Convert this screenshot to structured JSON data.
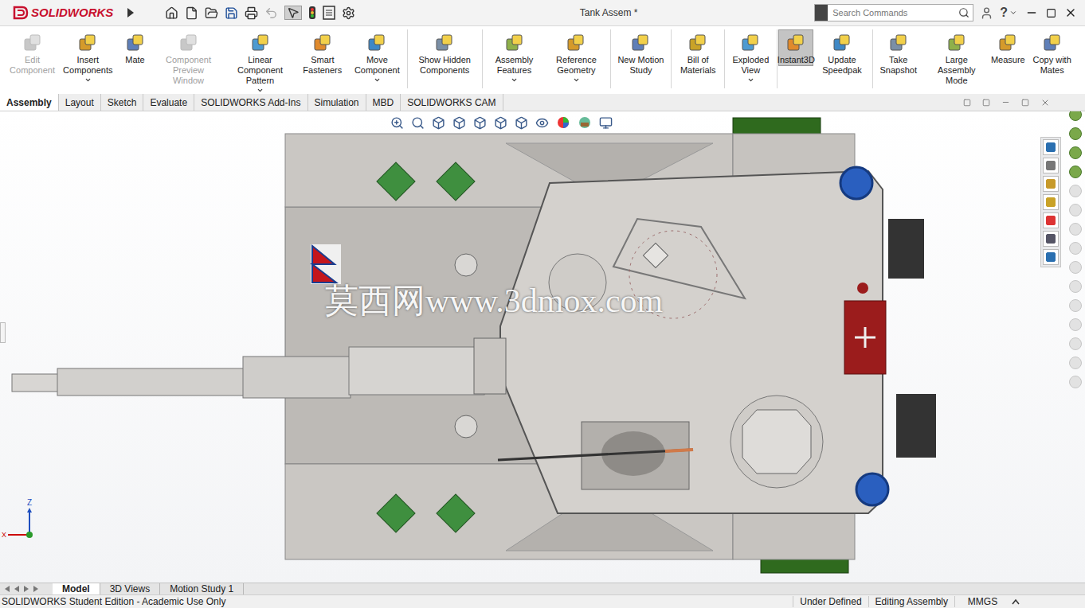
{
  "window": {
    "title": "Tank Assem *"
  },
  "app": {
    "logo": "SOLIDWORKS"
  },
  "search": {
    "placeholder": "Search Commands"
  },
  "help": "?",
  "ribbon": [
    {
      "label": "Edit Component",
      "disabled": true,
      "selected": false,
      "dropdown": false
    },
    {
      "label": "Insert Components",
      "disabled": false,
      "selected": false,
      "dropdown": true
    },
    {
      "label": "Mate",
      "disabled": false,
      "selected": false,
      "dropdown": false
    },
    {
      "label": "Component Preview Window",
      "disabled": true,
      "selected": false,
      "dropdown": false
    },
    {
      "label": "Linear Component Pattern",
      "disabled": false,
      "selected": false,
      "dropdown": true
    },
    {
      "label": "Smart Fasteners",
      "disabled": false,
      "selected": false,
      "dropdown": false
    },
    {
      "label": "Move Component",
      "disabled": false,
      "selected": false,
      "dropdown": true
    },
    {
      "label": "Show Hidden Components",
      "disabled": false,
      "selected": false,
      "dropdown": false
    },
    {
      "label": "Assembly Features",
      "disabled": false,
      "selected": false,
      "dropdown": true
    },
    {
      "label": "Reference Geometry",
      "disabled": false,
      "selected": false,
      "dropdown": true
    },
    {
      "label": "New Motion Study",
      "disabled": false,
      "selected": false,
      "dropdown": false
    },
    {
      "label": "Bill of Materials",
      "disabled": false,
      "selected": false,
      "dropdown": false
    },
    {
      "label": "Exploded View",
      "disabled": false,
      "selected": false,
      "dropdown": true
    },
    {
      "label": "Instant3D",
      "disabled": false,
      "selected": true,
      "dropdown": false
    },
    {
      "label": "Update Speedpak",
      "disabled": false,
      "selected": false,
      "dropdown": false
    },
    {
      "label": "Take Snapshot",
      "disabled": false,
      "selected": false,
      "dropdown": false
    },
    {
      "label": "Large Assembly Mode",
      "disabled": false,
      "selected": false,
      "dropdown": false
    },
    {
      "label": "Measure",
      "disabled": false,
      "selected": false,
      "dropdown": false
    },
    {
      "label": "Copy with Mates",
      "disabled": false,
      "selected": false,
      "dropdown": false
    }
  ],
  "tabs": [
    {
      "label": "Assembly",
      "selected": true
    },
    {
      "label": "Layout",
      "selected": false
    },
    {
      "label": "Sketch",
      "selected": false
    },
    {
      "label": "Evaluate",
      "selected": false
    },
    {
      "label": "SOLIDWORKS Add-Ins",
      "selected": false
    },
    {
      "label": "Simulation",
      "selected": false
    },
    {
      "label": "MBD",
      "selected": false
    },
    {
      "label": "SOLIDWORKS CAM",
      "selected": false
    }
  ],
  "watermark": "莫西网www.3dmox.com",
  "triad": {
    "z": "Z",
    "x": "X"
  },
  "bottom_tabs": [
    {
      "label": "Model",
      "selected": true
    },
    {
      "label": "3D Views",
      "selected": false
    },
    {
      "label": "Motion Study 1",
      "selected": false
    }
  ],
  "status_bar": {
    "left": "SOLIDWORKS Student Edition - Academic Use Only",
    "items": [
      "Under Defined",
      "Editing Assembly",
      "MMGS"
    ]
  }
}
